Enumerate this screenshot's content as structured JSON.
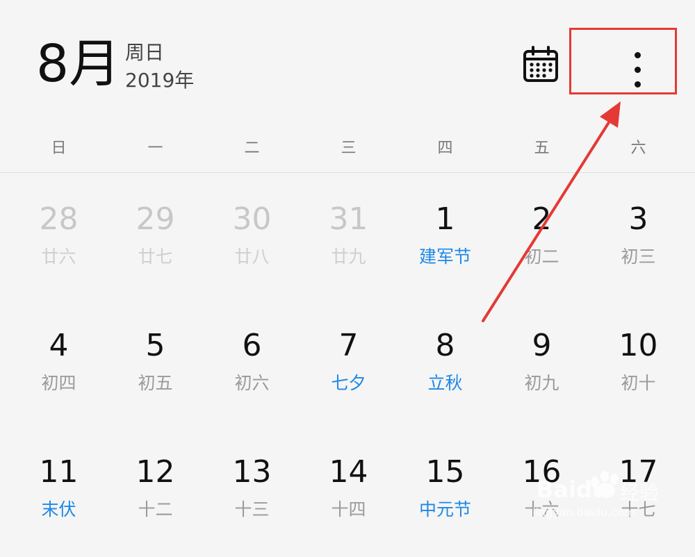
{
  "header": {
    "month": "8月",
    "weekday": "周日",
    "year": "2019年"
  },
  "icons": {
    "calendar": "calendar-icon",
    "more": "more-vertical-icon"
  },
  "colors": {
    "background": "#f5f5f5",
    "festival": "#1e88e5",
    "annotation": "#e53935"
  },
  "weekdays": [
    "日",
    "一",
    "二",
    "三",
    "四",
    "五",
    "六"
  ],
  "weeks": [
    [
      {
        "day": "28",
        "lunar": "廿六",
        "other": true
      },
      {
        "day": "29",
        "lunar": "廿七",
        "other": true
      },
      {
        "day": "30",
        "lunar": "廿八",
        "other": true
      },
      {
        "day": "31",
        "lunar": "廿九",
        "other": true
      },
      {
        "day": "1",
        "lunar": "建军节",
        "festival": true
      },
      {
        "day": "2",
        "lunar": "初二"
      },
      {
        "day": "3",
        "lunar": "初三"
      }
    ],
    [
      {
        "day": "4",
        "lunar": "初四"
      },
      {
        "day": "5",
        "lunar": "初五"
      },
      {
        "day": "6",
        "lunar": "初六"
      },
      {
        "day": "7",
        "lunar": "七夕",
        "festival": true
      },
      {
        "day": "8",
        "lunar": "立秋",
        "festival": true
      },
      {
        "day": "9",
        "lunar": "初九"
      },
      {
        "day": "10",
        "lunar": "初十"
      }
    ],
    [
      {
        "day": "11",
        "lunar": "末伏",
        "festival": true
      },
      {
        "day": "12",
        "lunar": "十二"
      },
      {
        "day": "13",
        "lunar": "十三"
      },
      {
        "day": "14",
        "lunar": "十四"
      },
      {
        "day": "15",
        "lunar": "中元节",
        "festival": true
      },
      {
        "day": "16",
        "lunar": "十六"
      },
      {
        "day": "17",
        "lunar": "十七"
      }
    ]
  ],
  "watermark": {
    "brand": "Baidu",
    "brand_cn": "经验",
    "url": "jingyan.baidu.com"
  }
}
